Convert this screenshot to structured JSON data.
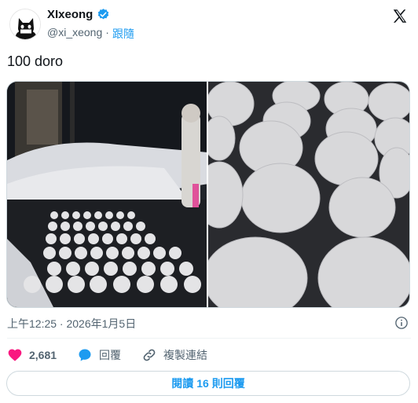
{
  "header": {
    "display_name": "XIxeong",
    "handle": "@xi_xeong",
    "separator": "·",
    "follow_label": "跟隨"
  },
  "tweet": {
    "text": "100 doro",
    "timestamp": "上午12:25 · 2026年1月5日"
  },
  "actions": {
    "likes_count": "2,681",
    "reply_label": "回覆",
    "copy_link_label": "複製連結"
  },
  "read_replies": {
    "prefix": "閱讀",
    "count": "16",
    "suffix": "則回覆"
  },
  "colors": {
    "accent": "#1d9bf0",
    "like": "#f91880",
    "muted": "#536471",
    "text": "#0f1419"
  }
}
